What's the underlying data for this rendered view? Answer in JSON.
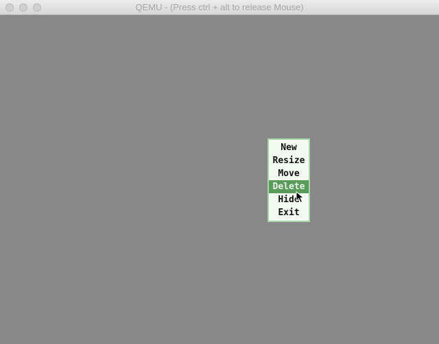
{
  "window": {
    "title": "QEMU - (Press ctrl + alt to release Mouse)"
  },
  "context_menu": {
    "items": [
      {
        "label": "New",
        "selected": false
      },
      {
        "label": "Resize",
        "selected": false
      },
      {
        "label": "Move",
        "selected": false
      },
      {
        "label": "Delete",
        "selected": true
      },
      {
        "label": "Hide",
        "selected": false
      },
      {
        "label": "Exit",
        "selected": false
      }
    ],
    "background_color": "#f2faf2",
    "border_color": "#a9d6a9",
    "highlight_color": "#5a9a5a"
  },
  "desktop": {
    "background_color": "#888888"
  },
  "icons": {
    "cursor": "arrow-cursor-icon"
  }
}
